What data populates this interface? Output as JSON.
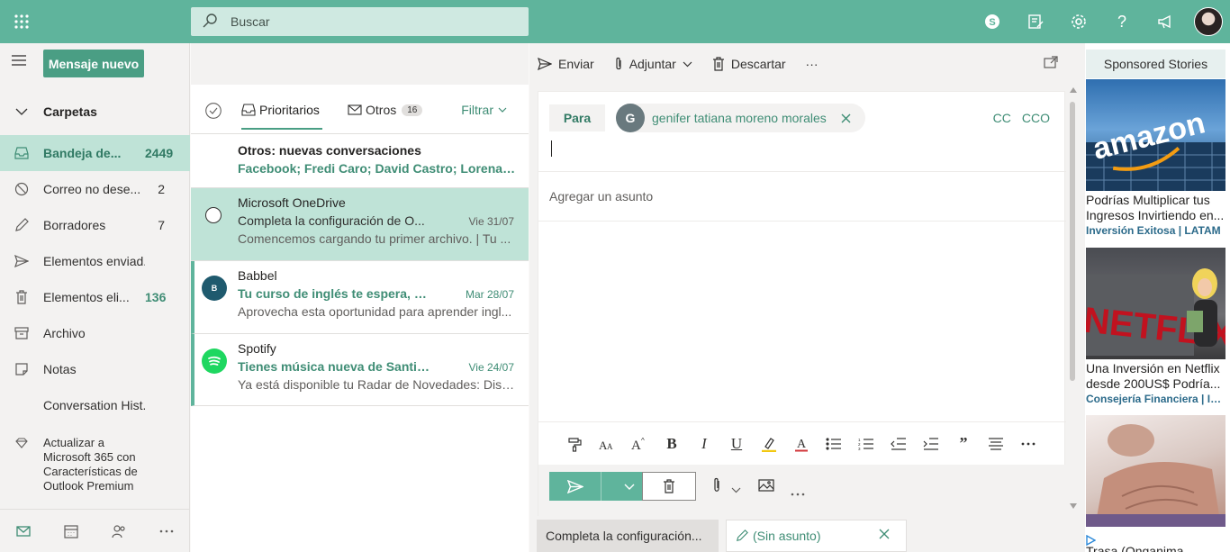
{
  "topbar": {
    "search_placeholder": "Buscar",
    "accent": "#5fb49c"
  },
  "nav": {
    "new_message": "Mensaje nuevo",
    "folders_header": "Carpetas",
    "folders": [
      {
        "name": "Bandeja de...",
        "count": "2449",
        "icon": "inbox-icon"
      },
      {
        "name": "Correo no dese...",
        "count": "2",
        "icon": "blocked-icon"
      },
      {
        "name": "Borradores",
        "count": "7",
        "icon": "pencil-icon"
      },
      {
        "name": "Elementos enviad...",
        "count": "",
        "icon": "send-icon"
      },
      {
        "name": "Elementos eli...",
        "count": "136",
        "icon": "trash-icon"
      },
      {
        "name": "Archivo",
        "count": "",
        "icon": "archive-icon"
      },
      {
        "name": "Notas",
        "count": "",
        "icon": "note-icon"
      },
      {
        "name": "Conversation Hist...",
        "count": "",
        "icon": ""
      }
    ],
    "upgrade": "Actualizar a Microsoft 365 con Características de Outlook Premium"
  },
  "list": {
    "tab_focused": "Prioritarios",
    "tab_other": "Otros",
    "tab_other_count": "16",
    "filter": "Filtrar",
    "items": [
      {
        "sender": "Otros: nuevas conversaciones",
        "subject": "Facebook; Fredi Caro; David Castro; Lorena Car...",
        "date": "",
        "preview": ""
      },
      {
        "sender": "Microsoft OneDrive",
        "subject": "Completa la configuración de O...",
        "date": "Vie 31/07",
        "preview": "Comencemos cargando tu primer archivo. | Tu ..."
      },
      {
        "sender": "Babbel",
        "subject": "Tu curso de inglés te espera, ah...",
        "date": "Mar 28/07",
        "preview": "Aprovecha esta oportunidad para aprender ingl...",
        "avatar": "B"
      },
      {
        "sender": "Spotify",
        "subject": "Tienes música nueva de Santia...",
        "date": "Vie 24/07",
        "preview": "Ya está disponible tu Radar de Novedades: Disfr..."
      }
    ]
  },
  "commands": {
    "send": "Enviar",
    "attach": "Adjuntar",
    "discard": "Descartar",
    "more": "···"
  },
  "compose": {
    "to_label": "Para",
    "recipient_initial": "G",
    "recipient_name": "genifer tatiana moreno morales",
    "cc": "CC",
    "bcc": "CCO",
    "subject_placeholder": "Agregar un asunto"
  },
  "bottom_tabs": [
    {
      "label": "Completa la configuración..."
    },
    {
      "label": "(Sin asunto)"
    }
  ],
  "ads": {
    "title": "Sponsored Stories",
    "items": [
      {
        "text": "Podrías Multiplicar tus Ingresos Invirtiendo en...",
        "source": "Inversión Exitosa | LATAM"
      },
      {
        "text": "Una Inversión en Netflix desde 200US$ Podría...",
        "source": "Consejería Financiera | Inv..."
      }
    ],
    "cut_text": "Trasa (Onganima...",
    "image_words": {
      "first": "amazon",
      "second": "NETFLIX"
    }
  }
}
